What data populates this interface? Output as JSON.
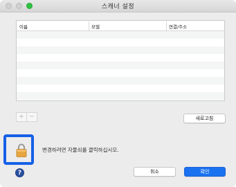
{
  "window": {
    "title": "스캐너 설정"
  },
  "table": {
    "columns": [
      "이름",
      "모델",
      "연결/주소"
    ],
    "rows": []
  },
  "controls": {
    "add_symbol": "+",
    "remove_symbol": "−",
    "refresh_label": "새로고침"
  },
  "lock": {
    "message": "변경하려면 자물쇠를 클릭하십시오.",
    "icon": "padlock-icon"
  },
  "footer": {
    "help_symbol": "?",
    "cancel_label": "취소",
    "ok_label": "확인"
  },
  "colors": {
    "accent": "#1a72f0",
    "highlight_border": "#1560e6",
    "zoom_button": "#2fc241"
  }
}
